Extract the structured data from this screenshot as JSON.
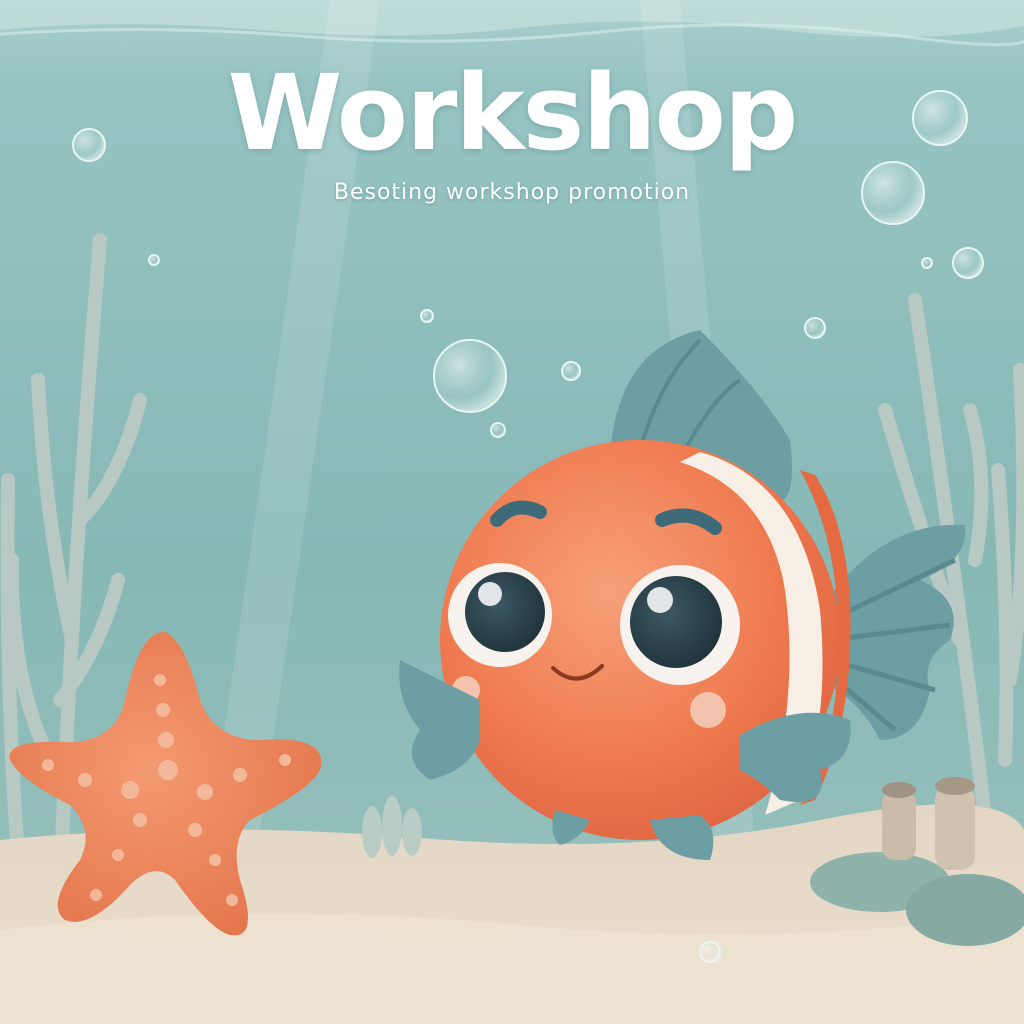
{
  "poster": {
    "title": "Workshop",
    "subtitle": "Besoting     workshop promotion"
  },
  "palette": {
    "water_top": "#a9cfcd",
    "water_bottom": "#86b8b6",
    "sand": "#e9dccb",
    "fish_body": "#f07a4f",
    "fish_fin": "#6d9ea3",
    "starfish": "#ef8a60",
    "seaweed": "#b7c9c2"
  }
}
